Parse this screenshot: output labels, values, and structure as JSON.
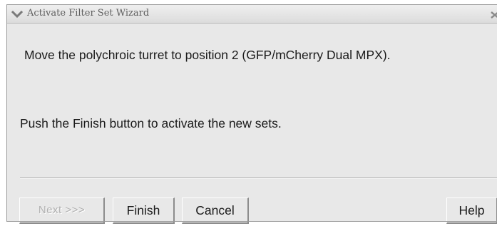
{
  "window": {
    "title": "Activate Filter Set Wizard",
    "menu_icon": "chevron-down-icon",
    "close_icon": "close-icon"
  },
  "messages": {
    "instruction": "Move the polychroic turret to position 2 (GFP/mCherry Dual MPX).",
    "finish_hint": "Push the Finish button to activate the new sets."
  },
  "buttons": {
    "next_label": "Next >>>",
    "next_enabled": false,
    "finish_label": "Finish",
    "cancel_label": "Cancel",
    "help_label": "Help"
  }
}
